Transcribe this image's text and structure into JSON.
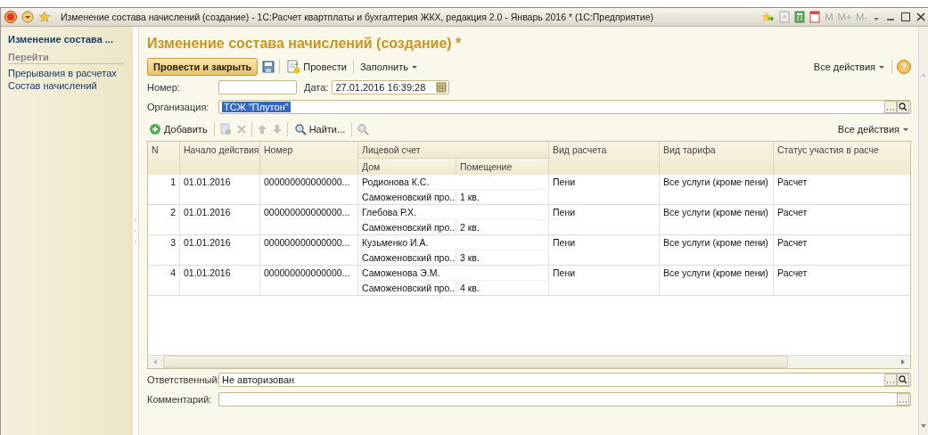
{
  "window": {
    "title": "Изменение состава начислений (создание) - 1С:Расчет квартплаты и бухгалтерия ЖКХ, редакция 2.0 - Январь 2016 * (1С:Предприятие)",
    "memory_keys": [
      "M",
      "M+",
      "M-"
    ]
  },
  "sidebar": {
    "title": "Изменение состава ...",
    "section": "Перейти",
    "items": [
      {
        "label": "Прерывания в расчетах"
      },
      {
        "label": "Состав начислений"
      }
    ]
  },
  "form": {
    "title": "Изменение состава начислений (создание) *",
    "toolbar": {
      "primary": "Провести и закрыть",
      "post": "Провести",
      "fill": "Заполнить",
      "all_actions": "Все действия",
      "help": "?"
    },
    "number": {
      "label": "Номер:"
    },
    "date": {
      "label": "Дата:",
      "value": "27.01.2016 16:39:28"
    },
    "organization": {
      "label": "Организация:",
      "value": "ТСЖ \"Плутон\"",
      "selected": true
    },
    "table_toolbar": {
      "add": "Добавить",
      "find": "Найти...",
      "all_actions": "Все действия"
    },
    "table": {
      "columns": [
        "N",
        "Начало действия",
        "Номер",
        "Лицевой счет",
        "Вид расчета",
        "Вид тарифа",
        "Статус участия в расче"
      ],
      "subcolumns": [
        "Дом",
        "Помещение"
      ],
      "rows": [
        {
          "n": "1",
          "start": "01.01.2016",
          "number": "000000000000000...",
          "account": "Родионова К.С.",
          "house": "Саможеновский про...",
          "room": "1 кв.",
          "calc": "Пени",
          "tariff": "Все услуги (кроме пени)",
          "status": "Расчет"
        },
        {
          "n": "2",
          "start": "01.01.2016",
          "number": "000000000000000...",
          "account": "Глебова Р.Х.",
          "house": "Саможеновский про...",
          "room": "2 кв.",
          "calc": "Пени",
          "tariff": "Все услуги (кроме пени)",
          "status": "Расчет"
        },
        {
          "n": "3",
          "start": "01.01.2016",
          "number": "000000000000000...",
          "account": "Кузьменко И.А.",
          "house": "Саможеновский про...",
          "room": "3 кв.",
          "calc": "Пени",
          "tariff": "Все услуги (кроме пени)",
          "status": "Расчет"
        },
        {
          "n": "4",
          "start": "01.01.2016",
          "number": "000000000000000...",
          "account": "Саможенова Э.М.",
          "house": "Саможеновский про...",
          "room": "4 кв.",
          "calc": "Пени",
          "tariff": "Все услуги (кроме пени)",
          "status": "Расчет"
        }
      ]
    },
    "responsible": {
      "label": "Ответственный:",
      "value": "Не авторизован"
    },
    "comment": {
      "label": "Комментарий:"
    }
  }
}
